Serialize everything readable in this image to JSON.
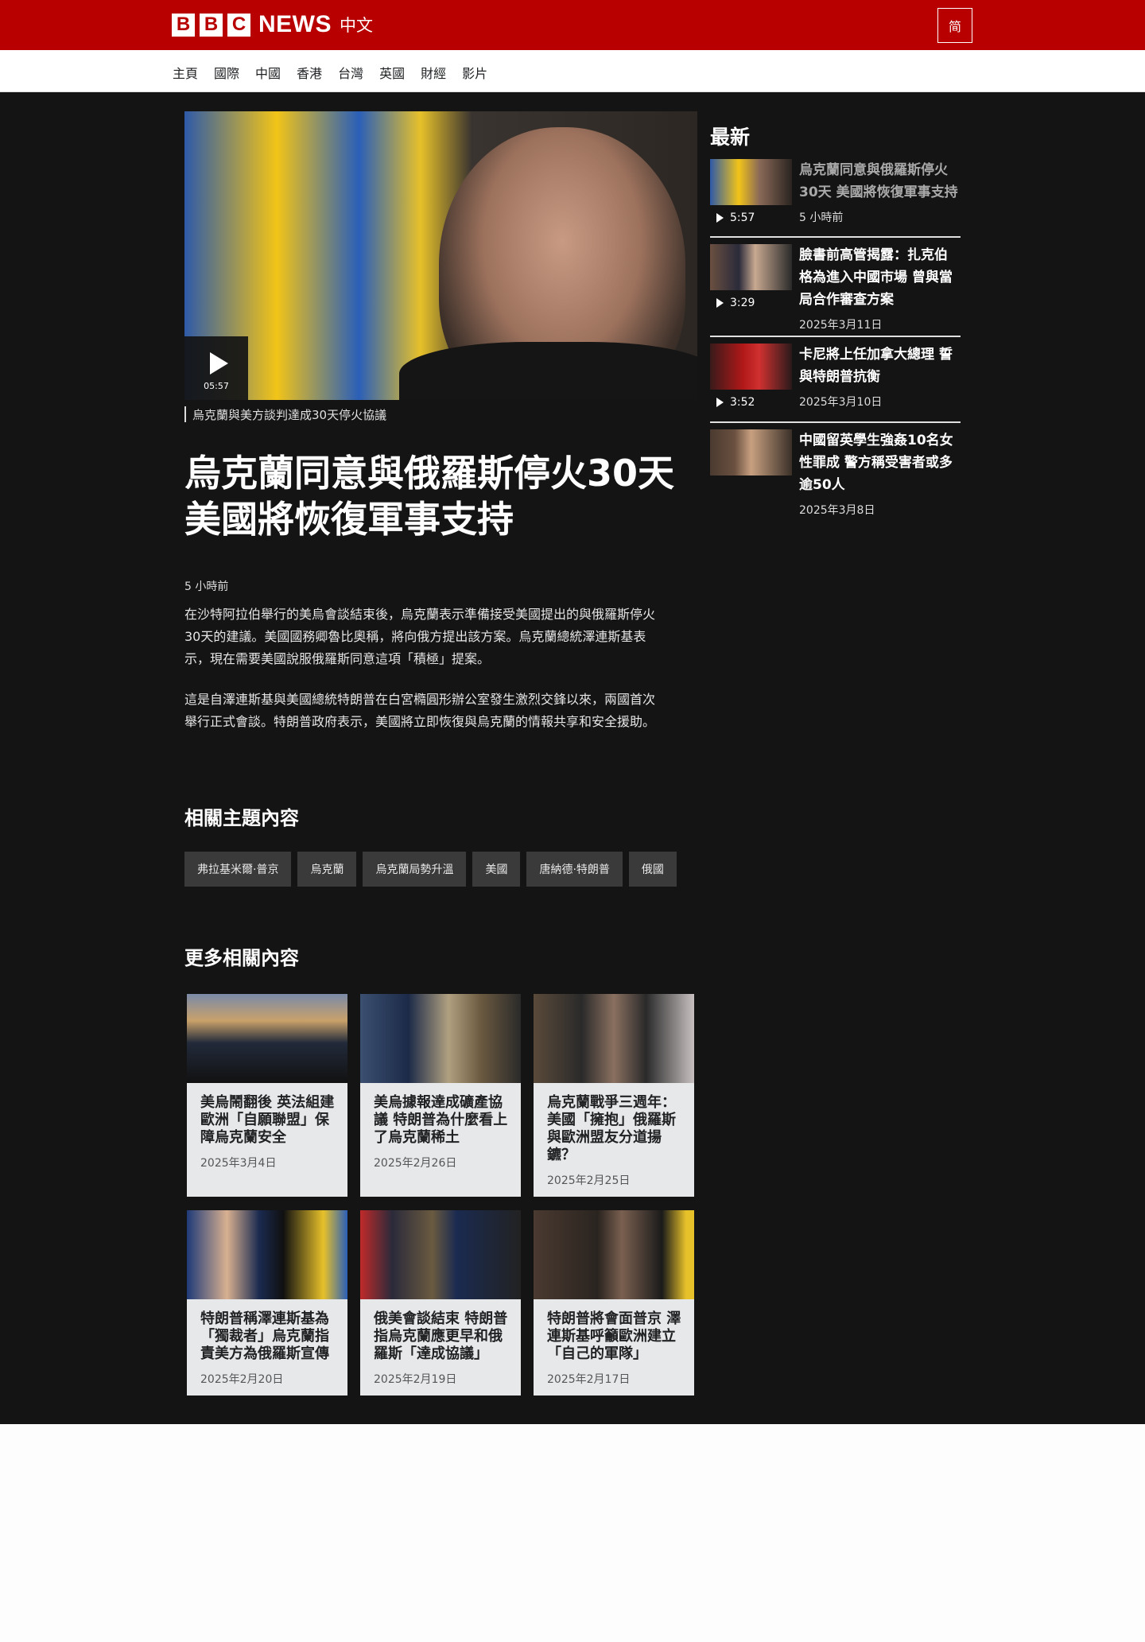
{
  "header": {
    "logo_letters": [
      "B",
      "B",
      "C"
    ],
    "logo_news": "NEWS",
    "logo_lang": "中文",
    "lang_toggle": "简",
    "brand_color": "#b80000"
  },
  "nav": {
    "items": [
      "主頁",
      "國際",
      "中國",
      "香港",
      "台灣",
      "英國",
      "財經",
      "影片"
    ]
  },
  "hero": {
    "duration": "05:57",
    "caption": "烏克蘭與美方談判達成30天停火協議",
    "icon": "play-icon"
  },
  "article": {
    "headline": "烏克蘭同意與俄羅斯停火30天 美國將恢復軍事支持",
    "timestamp": "5 小時前",
    "paragraphs": [
      "在沙特阿拉伯舉行的美烏會談結束後，烏克蘭表示準備接受美國提出的與俄羅斯停火30天的建議。美國國務卿魯比奧稱，將向俄方提出該方案。烏克蘭總統澤連斯基表示，現在需要美國說服俄羅斯同意這項「積極」提案。",
      "這是自澤連斯基與美國總統特朗普在白宮橢圓形辦公室發生激烈交鋒以來，兩國首次舉行正式會談。特朗普政府表示，美國將立即恢復與烏克蘭的情報共享和安全援助。"
    ]
  },
  "related_topics": {
    "title": "相關主題內容",
    "tags": [
      "弗拉基米爾·普京",
      "烏克蘭",
      "烏克蘭局勢升溫",
      "美國",
      "唐納德·特朗普",
      "俄國"
    ]
  },
  "more_related": {
    "title": "更多相關內容",
    "cards": [
      {
        "title": "美烏鬧翻後 英法組建歐洲「自願聯盟」保障烏克蘭安全",
        "date": "2025年3月4日"
      },
      {
        "title": "美烏據報達成礦產協議 特朗普為什麼看上了烏克蘭稀土",
        "date": "2025年2月26日"
      },
      {
        "title": "烏克蘭戰爭三週年：美國「擁抱」俄羅斯與歐洲盟友分道揚鑣？",
        "date": "2025年2月25日"
      },
      {
        "title": "特朗普稱澤連斯基為「獨裁者」烏克蘭指責美方為俄羅斯宣傳",
        "date": "2025年2月20日"
      },
      {
        "title": "俄美會談結束 特朗普指烏克蘭應更早和俄羅斯「達成協議」",
        "date": "2025年2月19日"
      },
      {
        "title": "特朗普將會面普京 澤連斯基呼籲歐洲建立「自己的軍隊」",
        "date": "2025年2月17日"
      }
    ]
  },
  "sidebar": {
    "title": "最新",
    "items": [
      {
        "title": "烏克蘭同意與俄羅斯停火30天 美國將恢復軍事支持",
        "duration": "5:57",
        "date": "5 小時前",
        "current": true
      },
      {
        "title": "臉書前高管揭露：扎克伯格為進入中國市場 曾與當局合作審查方案",
        "duration": "3:29",
        "date": "2025年3月11日"
      },
      {
        "title": "卡尼將上任加拿大總理 誓與特朗普抗衡",
        "duration": "3:52",
        "date": "2025年3月10日"
      },
      {
        "title": "中國留英學生強姦10名女性罪成 警方稱受害者或多逾50人",
        "duration": "",
        "date": "2025年3月8日"
      }
    ]
  }
}
